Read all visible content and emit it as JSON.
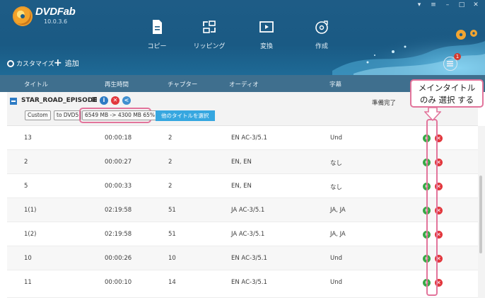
{
  "app": {
    "name": "DVDFab",
    "version": "10.0.3.6"
  },
  "window_controls": [
    "▾",
    "≡",
    "–",
    "□",
    "✕"
  ],
  "modules": [
    {
      "label": "コピー",
      "icon": "document-copy-icon"
    },
    {
      "label": "リッピング",
      "icon": "ripper-icon"
    },
    {
      "label": "変換",
      "icon": "video-convert-icon"
    },
    {
      "label": "作成",
      "icon": "disc-create-icon"
    }
  ],
  "toolbar": {
    "customize_label": "カスタマイズ",
    "add_label": "追加",
    "queue_badge": "1"
  },
  "columns": {
    "title": "タイトル",
    "duration": "再生時間",
    "chapters": "チャプター",
    "audio": "オーディオ",
    "subtitles": "字幕"
  },
  "source": {
    "name": "STAR_ROAD_EPISODE",
    "status": "準備完了",
    "profile": "Custom",
    "target": "to DVD5",
    "size_info": "6549 MB -> 4300 MB 65%",
    "select_title_label": "他のタイトルを選択"
  },
  "rows": [
    {
      "title": "13",
      "duration": "00:00:18",
      "chapters": "2",
      "audio": "EN AC-3/5.1",
      "subtitle": "Und"
    },
    {
      "title": "2",
      "duration": "00:00:27",
      "chapters": "2",
      "audio": "EN, EN",
      "subtitle": "なし"
    },
    {
      "title": "5",
      "duration": "00:00:33",
      "chapters": "2",
      "audio": "EN, EN",
      "subtitle": "なし"
    },
    {
      "title": "1(1)",
      "duration": "02:19:58",
      "chapters": "51",
      "audio": "JA AC-3/5.1",
      "subtitle": "JA, JA"
    },
    {
      "title": "1(2)",
      "duration": "02:19:58",
      "chapters": "51",
      "audio": "JA AC-3/5.1",
      "subtitle": "JA, JA"
    },
    {
      "title": "10",
      "duration": "00:00:26",
      "chapters": "10",
      "audio": "EN AC-3/5.1",
      "subtitle": "Und"
    },
    {
      "title": "11",
      "duration": "00:00:10",
      "chapters": "14",
      "audio": "EN AC-3/5.1",
      "subtitle": "Und"
    }
  ],
  "annotation": {
    "line1": "メインタイトル",
    "line2": "のみ 選択 する"
  },
  "colors": {
    "header": "#1e5c86",
    "column_header": "#3f6f8e",
    "highlight": "#e2749b",
    "accent_button": "#36a7e0",
    "play": "#3aa948",
    "delete": "#e2363c"
  }
}
